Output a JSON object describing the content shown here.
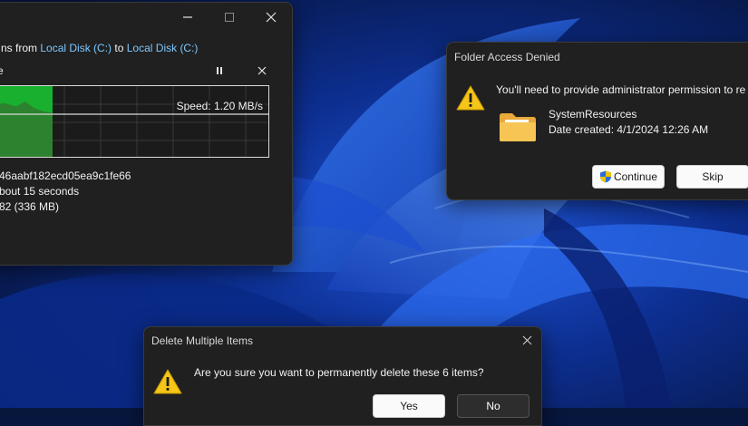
{
  "copy_dialog": {
    "heading_prefix": "ns from",
    "source": "Local Disk (C:)",
    "to_word": "to",
    "destination": "Local Disk (C:)",
    "stage_char": "e",
    "pause_icon": "pause-icon",
    "speed": "Speed: 1.20 MB/s",
    "progress_fraction": 0.22,
    "item_name": "46aabf182ecd05ea9c1fe66",
    "time_remaining": "bout 15 seconds",
    "items_remaining": "82 (336 MB)",
    "minimize_icon": "minimize-icon",
    "maximize_icon": "maximize-icon",
    "close_icon": "close-icon"
  },
  "access_dialog": {
    "title": "Folder Access Denied",
    "message": "You'll need to provide administrator permission to re",
    "folder_name": "SystemResources",
    "date_created": "Date created: 4/1/2024 12:26 AM",
    "continue_label": "Continue",
    "skip_label": "Skip",
    "warning_icon": "warning-icon",
    "shield_icon": "uac-shield-icon"
  },
  "delete_dialog": {
    "title": "Delete Multiple Items",
    "message": "Are you sure you want to permanently delete these 6 items?",
    "yes_label": "Yes",
    "no_label": "No"
  },
  "colors": {
    "graph_fill": "#19b030",
    "link": "#7ec8ff",
    "window_bg": "#202020"
  }
}
